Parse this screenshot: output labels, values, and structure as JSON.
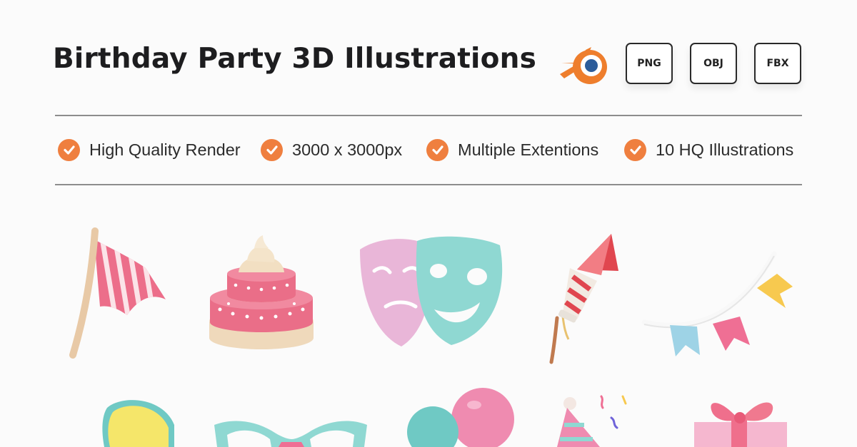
{
  "header": {
    "title": "Birthday Party 3D Illustrations",
    "software_icon": "blender-logo-icon",
    "formats": [
      "PNG",
      "OBJ",
      "FBX"
    ]
  },
  "features": [
    {
      "icon": "check-circle-icon",
      "label": "High Quality Render"
    },
    {
      "icon": "check-circle-icon",
      "label": "3000 x 3000px"
    },
    {
      "icon": "check-circle-icon",
      "label": "Multiple Extentions"
    },
    {
      "icon": "check-circle-icon",
      "label": "10 HQ Illustrations"
    }
  ],
  "illustrations": [
    "party-flag-icon",
    "birthday-cake-icon",
    "theater-masks-icon",
    "firework-rocket-icon",
    "bunting-garland-icon",
    "party-horn-icon",
    "party-eye-mask-icon",
    "balloons-icon",
    "party-hat-icon",
    "gift-box-icon"
  ],
  "colors": {
    "accent_orange": "#ef7f3f",
    "pink": "#ee6f8c",
    "mint": "#8fd8d2",
    "cream": "#f2dfc2",
    "yellow": "#f7c94f",
    "light_blue": "#9ed3e6"
  }
}
